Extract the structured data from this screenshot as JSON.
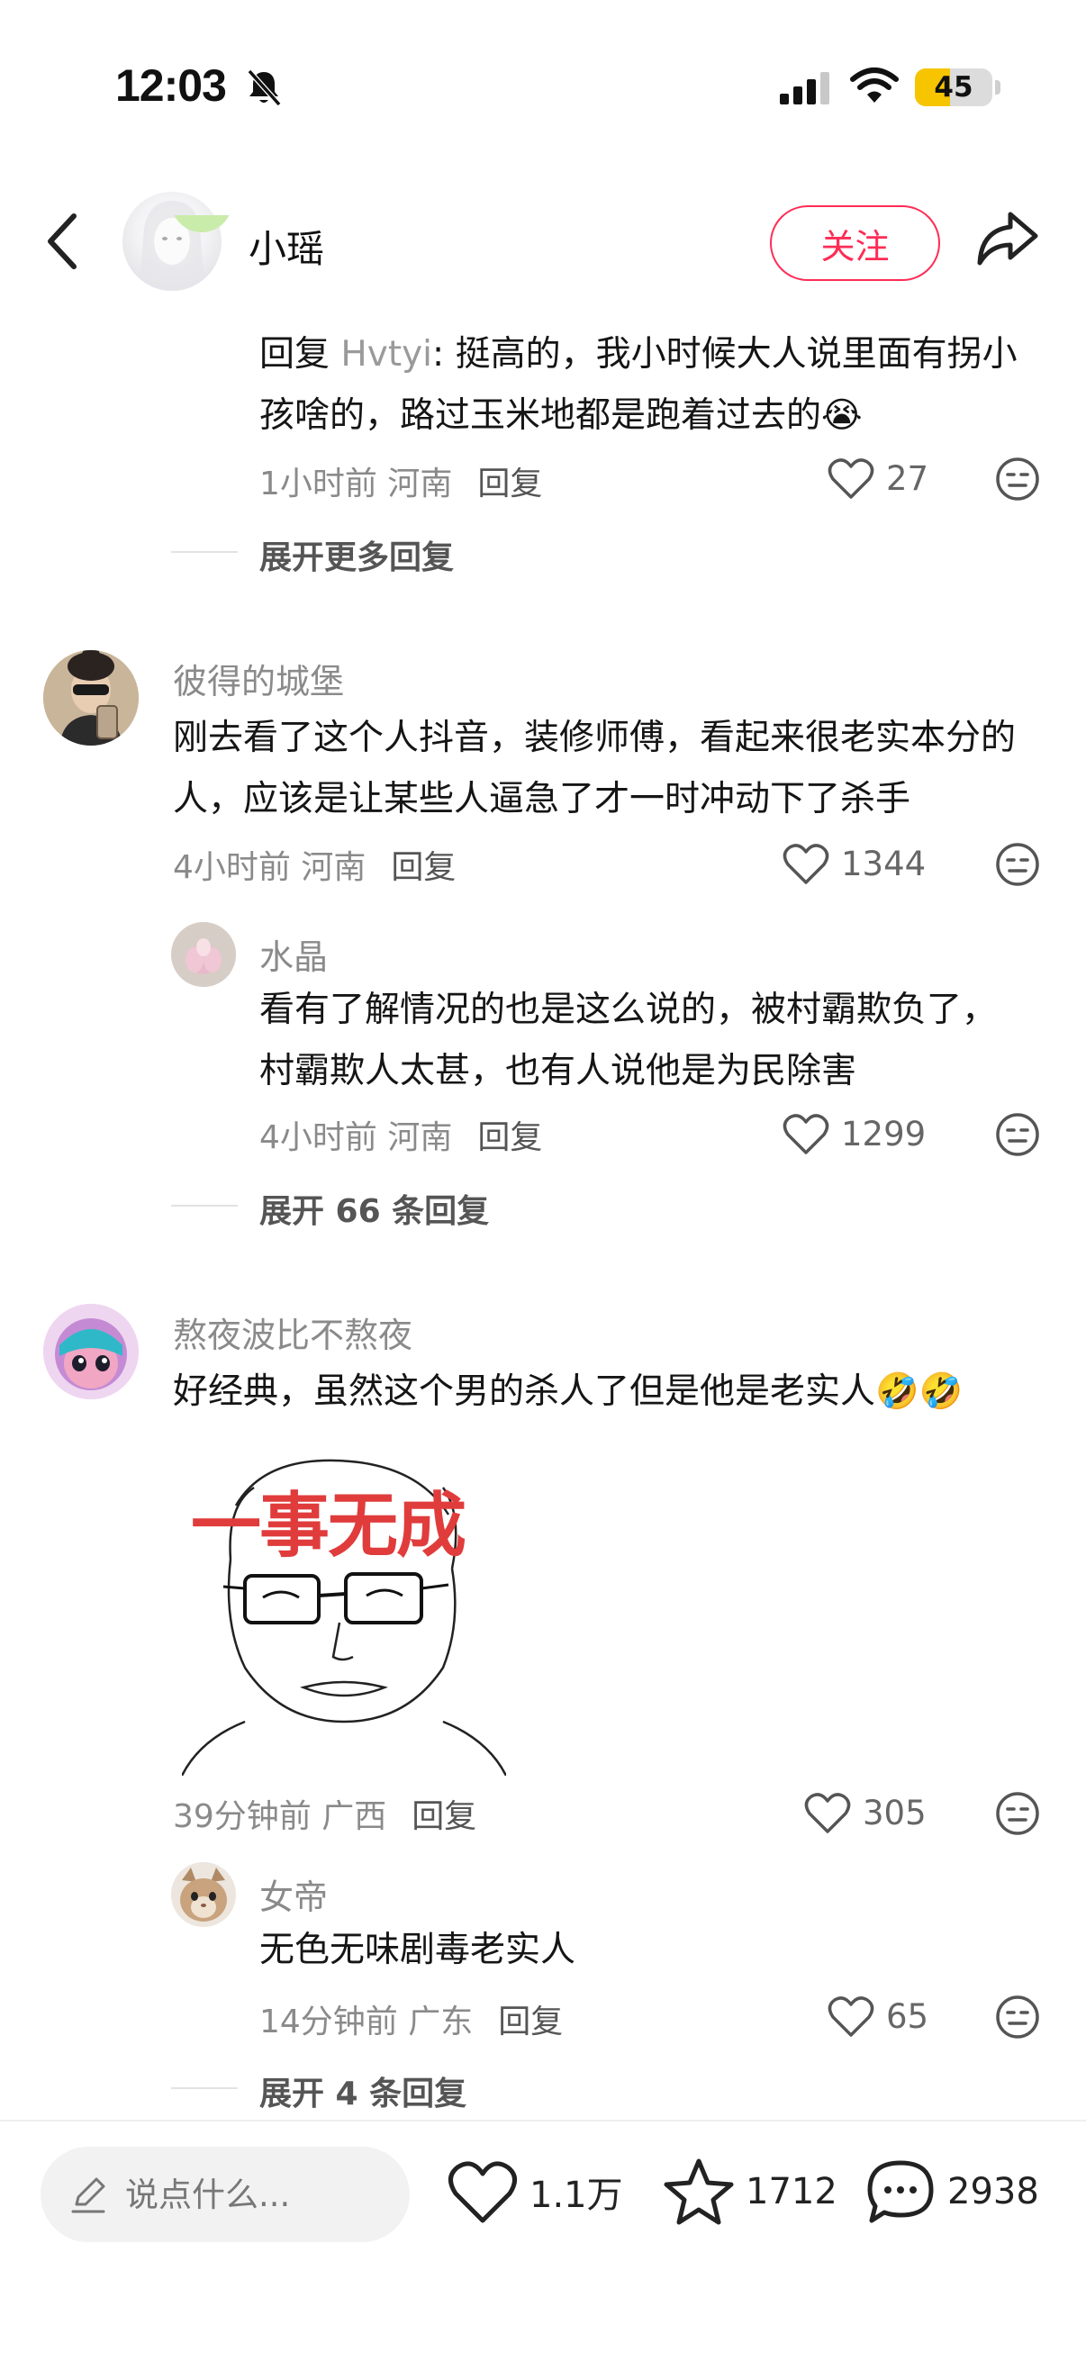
{
  "status_bar": {
    "time": "12:03",
    "battery": "45",
    "battery_level": 0.45
  },
  "header": {
    "title": "小瑶",
    "follow_label": "关注"
  },
  "comments": [
    {
      "replies": [
        {
          "prefix": "回复 ",
          "reply_to": "Hvtyi",
          "text": ": 挺高的，我小时候大人说里面有拐小孩啥的，路过玉米地都是跑着过去的",
          "emoji": "😭",
          "time_location": "1小时前 河南",
          "reply_label": "回复",
          "likes": "27"
        }
      ],
      "expand_label": "展开更多回复"
    },
    {
      "username": "彼得的城堡",
      "text": "刚去看了这个人抖音，装修师傅，看起来很老实本分的人，应该是让某些人逼急了才一时冲动下了杀手",
      "time_location": "4小时前 河南",
      "reply_label": "回复",
      "likes": "1344",
      "replies": [
        {
          "username": "水晶",
          "text": "看有了解情况的也是这么说的，被村霸欺负了，村霸欺人太甚，也有人说他是为民除害",
          "time_location": "4小时前 河南",
          "reply_label": "回复",
          "likes": "1299"
        }
      ],
      "expand_label": "展开 66 条回复"
    },
    {
      "username": "熬夜波比不熬夜",
      "text": "好经典，虽然这个男的杀人了但是他是老实人",
      "emoji": "🤣🤣",
      "image_caption": "一事无成",
      "time_location": "39分钟前 广西",
      "reply_label": "回复",
      "likes": "305",
      "replies": [
        {
          "username": "女帝",
          "text": "无色无味剧毒老实人",
          "time_location": "14分钟前 广东",
          "reply_label": "回复",
          "likes": "65"
        }
      ],
      "expand_label": "展开 4 条回复"
    }
  ],
  "bottom_bar": {
    "input_placeholder": "说点什么...",
    "likes": "1.1万",
    "favorites": "1712",
    "comments": "2938"
  },
  "colors": {
    "accent": "#fe2c55",
    "battery": "#f6c500",
    "meme_text": "#e03c3c"
  }
}
